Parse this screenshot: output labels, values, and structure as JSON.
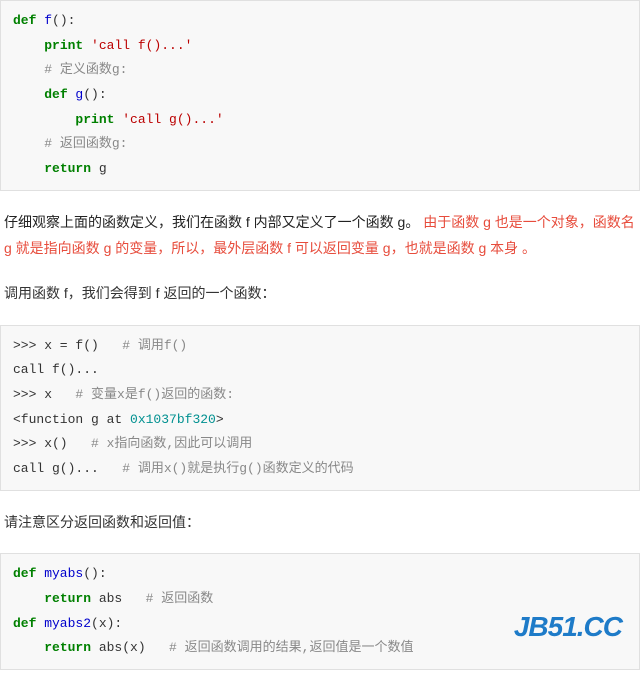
{
  "code1": {
    "l1a": "def",
    "l1b": " f",
    "l1c": "():",
    "l2a": "    ",
    "l2b": "print",
    "l2c": " ",
    "l2d": "'call f()...'",
    "l3a": "    ",
    "l3b": "# 定义函数g:",
    "l4a": "    ",
    "l4b": "def",
    "l4c": " g",
    "l4d": "():",
    "l5a": "        ",
    "l5b": "print",
    "l5c": " ",
    "l5d": "'call g()...'",
    "l6a": "    ",
    "l6b": "# 返回函数g:",
    "l7a": "    ",
    "l7b": "return",
    "l7c": " g"
  },
  "para1": {
    "t1": "仔细观察上面的函数定义，我们在函数 f 内部又定义了一个函数 g。",
    "t2": "由于函数 g 也是一个对象，函数名 g 就是指向函数 g 的变量，所以，最外层函数 f 可以返回变量 g，也就是函数 g 本身 。"
  },
  "para2": "调用函数 f，我们会得到 f 返回的一个函数：",
  "code2": {
    "l1a": ">>> x = f()   ",
    "l1b": "# 调用f()",
    "l2": "call f()...",
    "l3a": ">>> x   ",
    "l3b": "# 变量x是f()返回的函数:",
    "l4a": "<function g at ",
    "l4b": "0x1037bf320",
    "l4c": ">",
    "l5a": ">>> x()   ",
    "l5b": "# x指向函数,因此可以调用",
    "l6a": "call g()...   ",
    "l6b": "# 调用x()就是执行g()函数定义的代码"
  },
  "para3": "请注意区分返回函数和返回值：",
  "code3": {
    "l1a": "def",
    "l1b": " myabs",
    "l1c": "():",
    "l2a": "    ",
    "l2b": "return",
    "l2c": " abs   ",
    "l2d": "# 返回函数",
    "l3a": "def",
    "l3b": " myabs2",
    "l3c": "(x):",
    "l4a": "    ",
    "l4b": "return",
    "l4c": " abs(x)   ",
    "l4d": "# 返回函数调用的结果,返回值是一个数值"
  },
  "watermark": "JB51.CC"
}
